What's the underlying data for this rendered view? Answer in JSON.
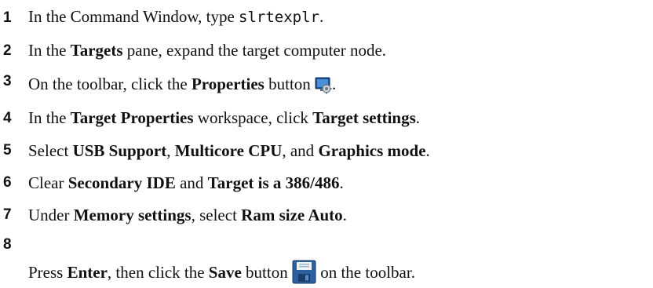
{
  "steps": [
    {
      "number": "1",
      "parts": [
        "In the Command Window, type ",
        "slrtexplr",
        "."
      ]
    },
    {
      "number": "2",
      "parts": [
        "In the ",
        "Targets",
        " pane, expand the target computer node."
      ]
    },
    {
      "number": "3",
      "parts": [
        "On the toolbar, click the ",
        "Properties",
        " button ",
        "."
      ],
      "icon": "properties-icon"
    },
    {
      "number": "4",
      "parts": [
        "In the ",
        "Target Properties",
        " workspace, click ",
        "Target settings",
        "."
      ]
    },
    {
      "number": "5",
      "parts": [
        "Select ",
        "USB Support",
        ", ",
        "Multicore CPU",
        ", and ",
        "Graphics mode",
        "."
      ]
    },
    {
      "number": "6",
      "parts": [
        "Clear ",
        "Secondary IDE",
        " and ",
        "Target is a 386/486",
        "."
      ]
    },
    {
      "number": "7",
      "parts": [
        "Under ",
        "Memory settings",
        ", select ",
        "Ram size Auto",
        "."
      ]
    },
    {
      "number": "8",
      "parts": [
        "Press ",
        "Enter",
        ", then click the ",
        "Save",
        " button ",
        " on the toolbar."
      ],
      "icon": "save-floppy-icon"
    }
  ]
}
